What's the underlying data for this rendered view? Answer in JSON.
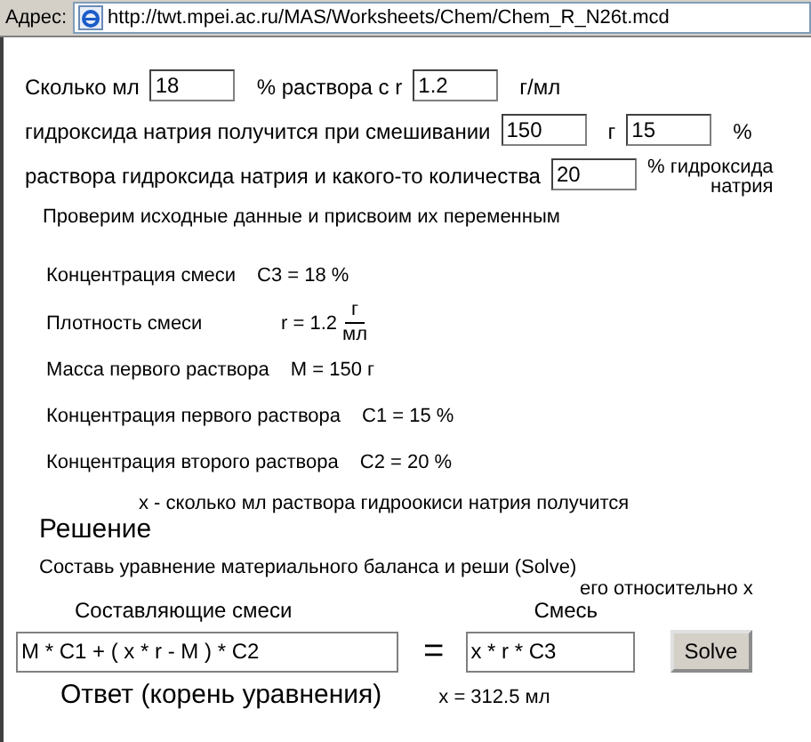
{
  "address_bar": {
    "label": "Адрес:",
    "url": "http://twt.mpei.ac.ru/MAS/Worksheets/Chem/Chem_R_N26t.mcd"
  },
  "problem_lines": [
    [
      {
        "kind": "text",
        "text": "Сколько мл"
      },
      {
        "kind": "field",
        "value": "18"
      },
      {
        "kind": "text",
        "text": "% раствора с r"
      },
      {
        "kind": "field",
        "value": "1.2"
      },
      {
        "kind": "text",
        "text": "г/мл"
      }
    ],
    [
      {
        "kind": "text",
        "text": "гидроксида натрия получится при смешивании"
      },
      {
        "kind": "field",
        "value": "150"
      },
      {
        "kind": "text",
        "text": "г"
      },
      {
        "kind": "field",
        "value": "15"
      },
      {
        "kind": "text",
        "text": "%"
      }
    ],
    [
      {
        "kind": "text",
        "text": "раствора гидроксида натрия и какого-то количества"
      },
      {
        "kind": "field",
        "value": "20"
      },
      {
        "kind": "wrapped",
        "text": "% гидроксида",
        "continuation": "натрия"
      }
    ]
  ],
  "check_heading": "Проверим исходные данные и присвоим их переменным",
  "definitions": [
    {
      "kind": "plain",
      "label": "Концентрация смеси",
      "expression": "C3 = 18 %"
    },
    {
      "kind": "fraction",
      "label": "Плотность смеси",
      "expression": "r = 1.2",
      "numerator": "г",
      "denominator": "мл"
    },
    {
      "kind": "plain",
      "label": "Масса первого раствора",
      "expression": "M = 150 г"
    },
    {
      "kind": "plain",
      "label": "Концентрация первого раствора",
      "expression": "C1 = 15 %"
    },
    {
      "kind": "plain",
      "label": "Концентрация второго раствора",
      "expression": "C2 = 20 %"
    }
  ],
  "unknown_note": "x - сколько мл раствора гидроокиси натрия получится",
  "solution_heading": "Решение",
  "instruction": "Составь уравнение материального баланса и реши (Solve)",
  "instruction_continuation": "его относительно x",
  "components_label": "Составляющие смеси",
  "mixture_label": "Смесь",
  "left_side": "M * C1 + ( x * r - M ) * C2",
  "equals": "=",
  "right_side": "x * r * C3",
  "solve_button": "Solve",
  "answer_label": "Ответ (корень уравнения)",
  "answer_value": "x = 312.5 мл"
}
